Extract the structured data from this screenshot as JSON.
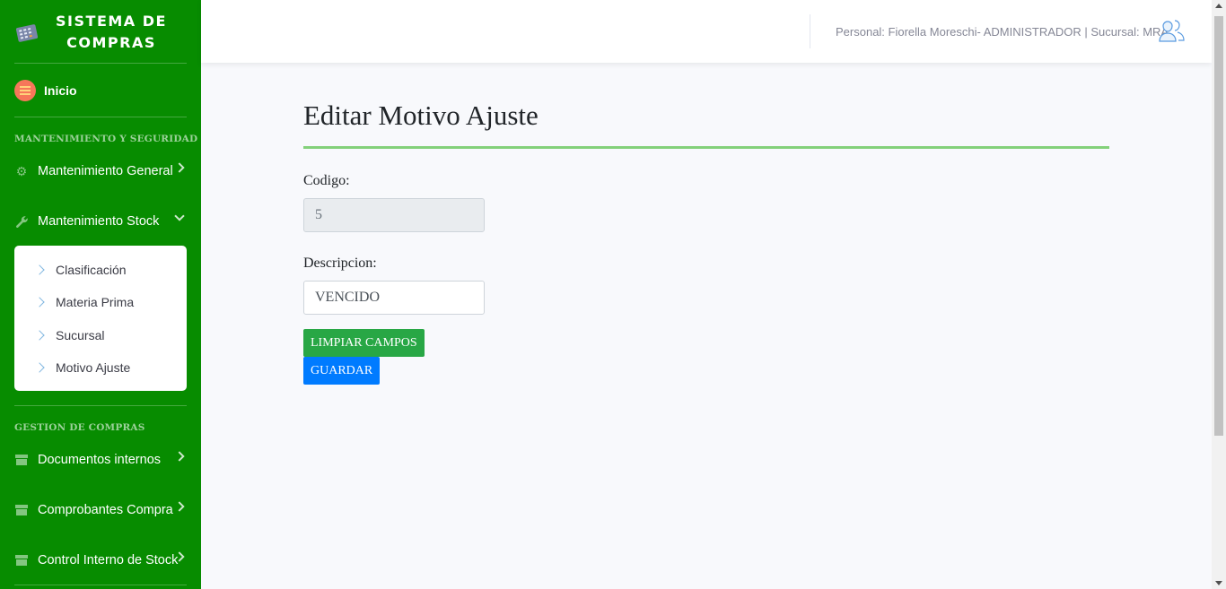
{
  "sidebar": {
    "brand": "SISTEMA DE COMPRAS",
    "inicio": "Inicio",
    "section_mantenimiento": "MANTENIMIENTO Y SEGURIDAD",
    "mantenimiento_general": "Mantenimiento General",
    "mantenimiento_stock": "Mantenimiento Stock",
    "submenu": [
      "Clasificación",
      "Materia Prima",
      "Sucursal",
      "Motivo Ajuste"
    ],
    "section_compras": "GESTION DE COMPRAS",
    "documentos_internos": "Documentos internos",
    "comprobantes_compra": "Comprobantes Compra",
    "control_interno_stock": "Control Interno de Stock"
  },
  "topbar": {
    "user_info": "Personal: Fiorella Moreschi- ADMINISTRADOR | Sucursal: MRA"
  },
  "main": {
    "title": "Editar Motivo Ajuste",
    "codigo_label": "Codigo:",
    "codigo_value": "5",
    "descripcion_label": "Descripcion:",
    "descripcion_value": "VENCIDO",
    "clear_button": "LIMPIAR CAMPOS",
    "save_button": "GUARDAR"
  },
  "colors": {
    "sidebar": "#078c00",
    "accent_rule": "#83d17a",
    "clear_button": "#28a745",
    "save_button": "#007bff"
  }
}
